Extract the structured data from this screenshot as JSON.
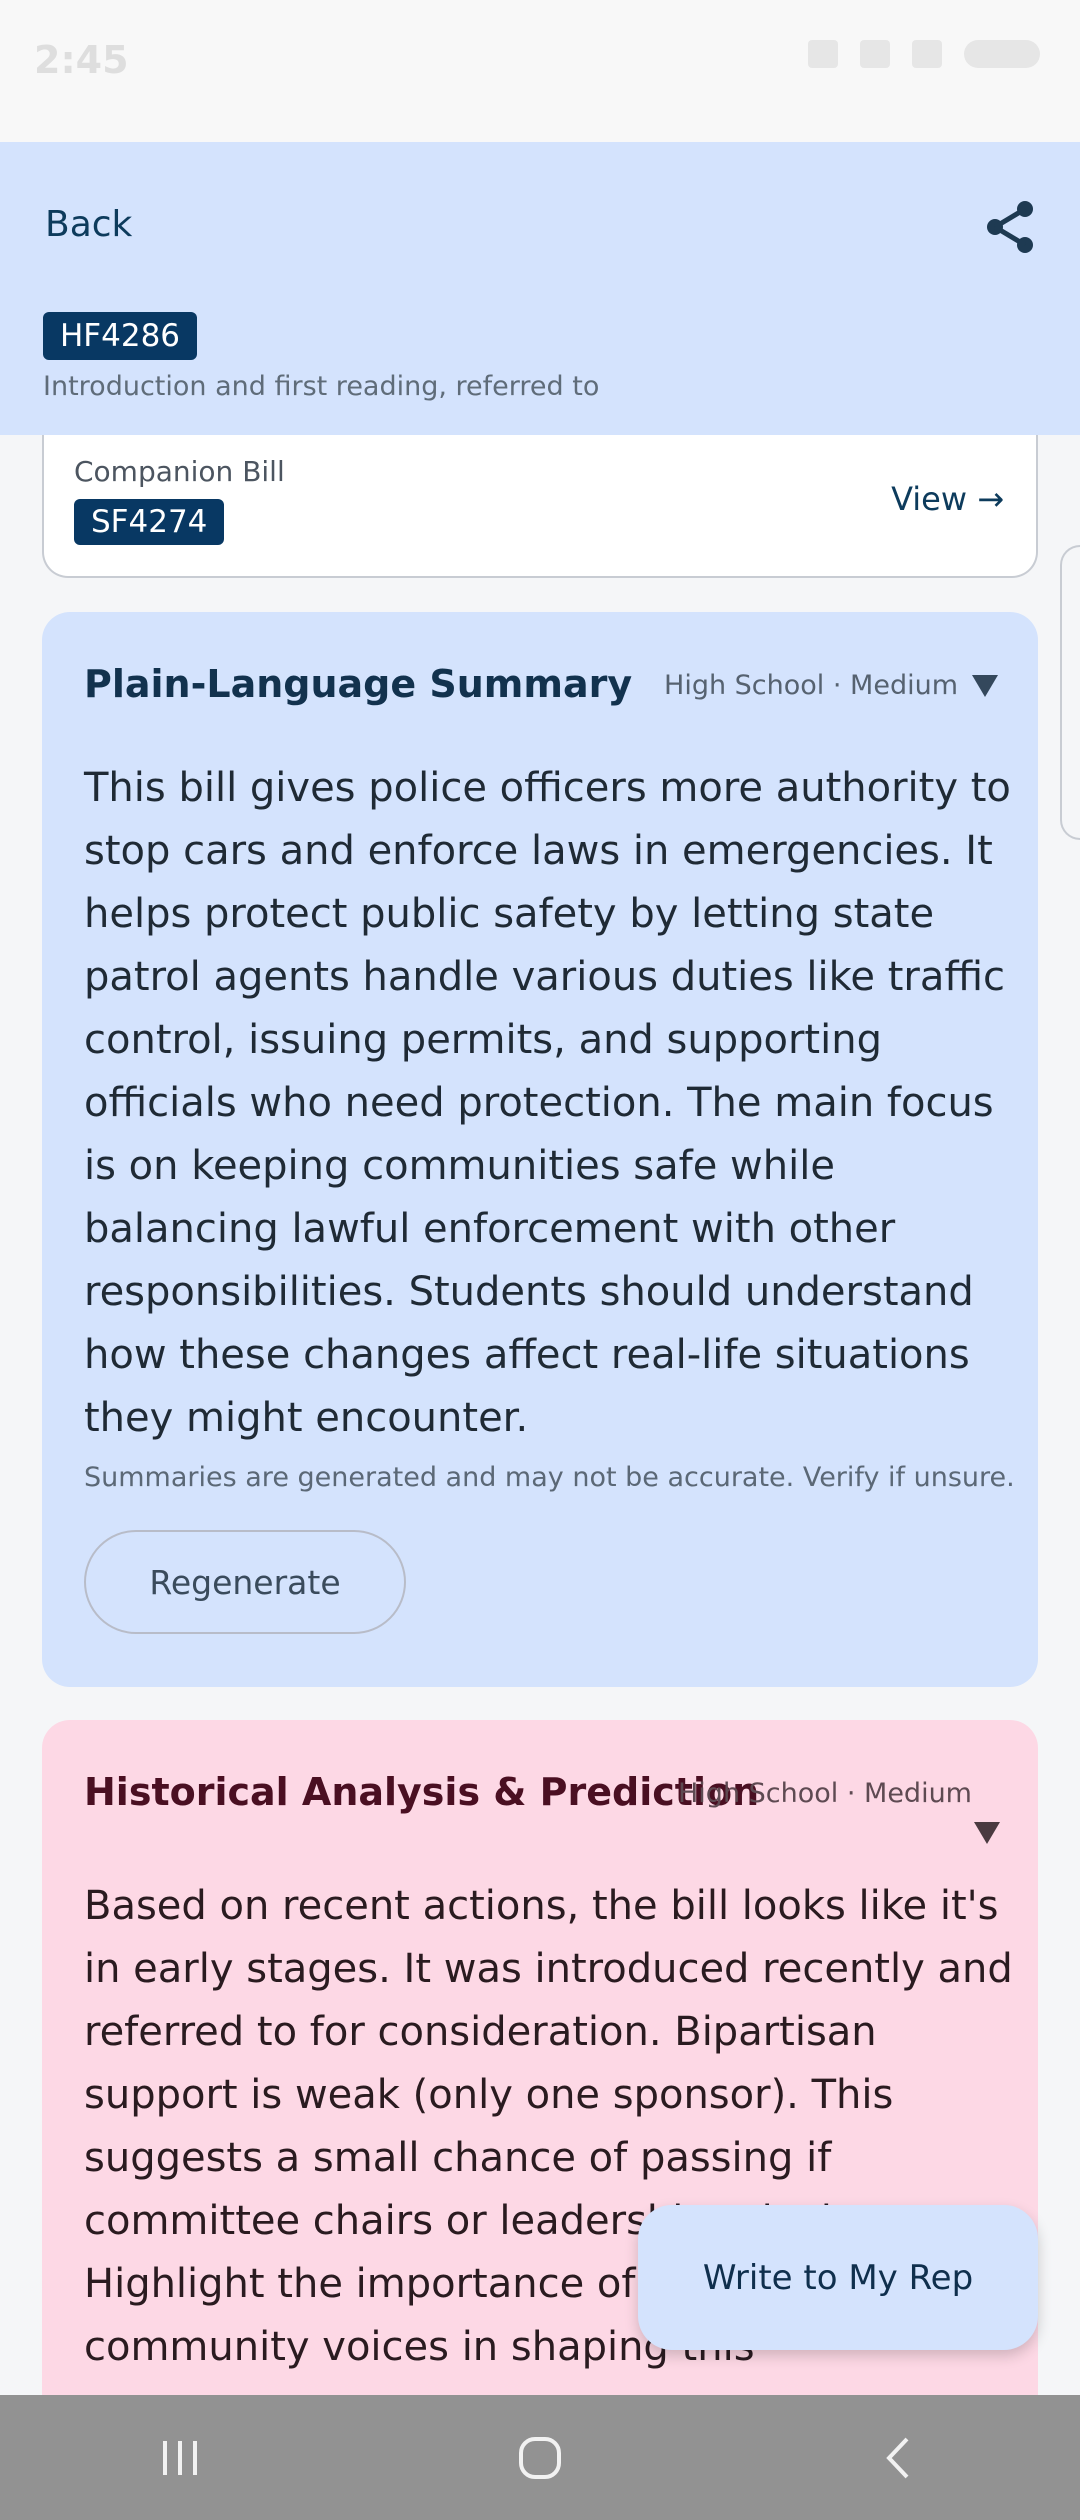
{
  "status_bar": {
    "time": "2:45"
  },
  "header": {
    "back_label": "Back",
    "share_icon": "share-icon",
    "bill_id": "HF4286",
    "bill_status": "Introduction and first reading, referred to"
  },
  "companion": {
    "label": "Companion Bill",
    "bill_id": "SF4274",
    "view_label": "View →"
  },
  "summary": {
    "title": "Plain-Language Summary",
    "level": "High School · Medium",
    "body": "This bill gives police officers more authority to stop cars and enforce laws in emergencies. It helps protect public safety by letting state patrol agents handle various duties like traffic control, issuing permits, and supporting officials who need protection. The main focus is on keeping communities safe while balancing lawful enforcement with other responsibilities. Students should understand how these changes affect real-life situations they might encounter.",
    "disclaimer": "Summaries are generated and may not be accurate. Verify if unsure.",
    "regenerate_label": "Regenerate"
  },
  "history": {
    "title": "Historical Analysis & Prediction",
    "level": "High School · Medium",
    "body": "Based on recent actions, the bill looks like it's in early stages. It was introduced recently and referred to for consideration. Bipartisan support is weak (only one sponsor). This suggests a small chance of passing if committee chairs or leadership take it up. Highlight the importance of advocacy and community voices in shaping this"
  },
  "fab": {
    "label": "Write to My Rep"
  },
  "colors": {
    "header_bg": "#d4e3fd",
    "chip_bg": "#083863",
    "history_bg": "#fdd8e5",
    "nav_bg": "#929292"
  }
}
